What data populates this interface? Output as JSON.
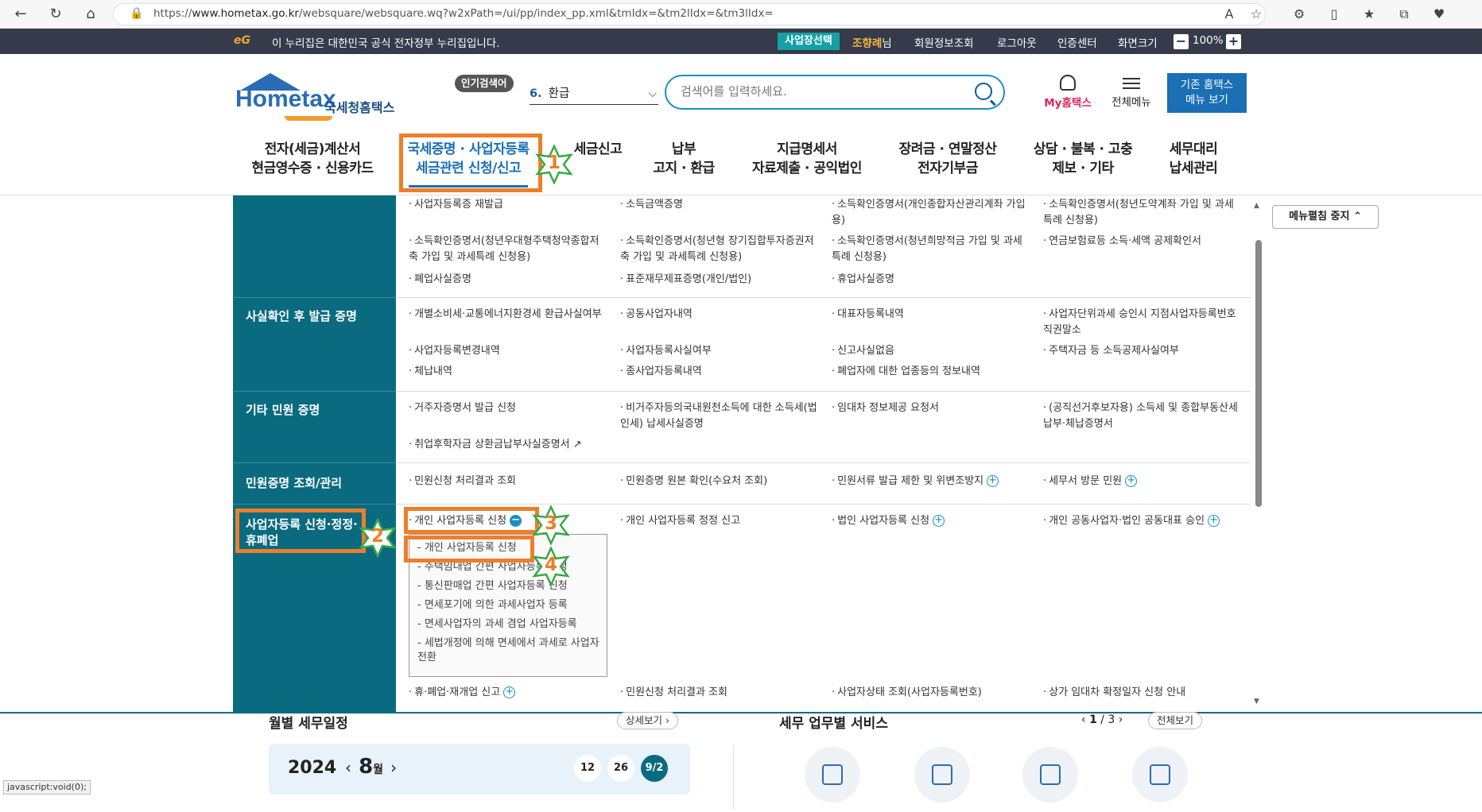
{
  "browser": {
    "url_prefix": "https://",
    "url_host": "www.hometax.go.kr",
    "url_path": "/websquare/websquare.wq?w2xPath=/ui/pp/index_pp.xml&tmIdx=&tm2lIdx=&tm3lIdx="
  },
  "topbar": {
    "gov_notice": "이 누리집은 대한민국 공식 전자정부 누리집입니다.",
    "biz_select": "사업장선택",
    "user_name": "조향례",
    "user_suffix": "님",
    "menus": [
      "회원정보조회",
      "로그아웃",
      "인증센터",
      "화면크기"
    ],
    "zoom": "100%"
  },
  "header": {
    "logo_text": "Hometax",
    "logo_sub": "국세청홈택스",
    "popular_tag": "인기검색어",
    "popular_num": "6.",
    "popular_term": "환급",
    "search_placeholder": "검색어를 입력하세요.",
    "my_hometax": "My홈택스",
    "all_menu": "전체메뉴",
    "old_hometax_line1": "기존 홈택스",
    "old_hometax_line2": "메뉴 보기"
  },
  "gnb": [
    {
      "l1": "전자(세금)계산서",
      "l2": "현금영수증 · 신용카드"
    },
    {
      "l1": "국세증명 · 사업자등록",
      "l2": "세금관련 신청/신고"
    },
    {
      "l1": "세금신고",
      "l2": ""
    },
    {
      "l1": "납부",
      "l2": "고지 · 환급"
    },
    {
      "l1": "지급명세서",
      "l2": "자료제출 · 공익법인"
    },
    {
      "l1": "장려금 · 연말정산",
      "l2": "전자기부금"
    },
    {
      "l1": "상담 · 불복 · 고충",
      "l2": "제보 · 기타"
    },
    {
      "l1": "세무대리",
      "l2": "납세관리"
    }
  ],
  "annotations": [
    "1",
    "2",
    "3",
    "4"
  ],
  "categories": [
    "사실확인 후 발급 증명",
    "기타 민원 증명",
    "민원증명 조회/관리",
    "사업자등록 신청·정정·휴폐업"
  ],
  "rows": {
    "r0": [
      "사업자등록증 재발급",
      "소득금액증명",
      "소득확인증명서(개인종합자산관리계좌 가입용)",
      "소득확인증명서(청년도약계좌 가입 및 과세특례 신청용)"
    ],
    "r1": [
      "소득확인증명서(청년우대형주택청약종합저축 가입 및 과세특례 신청용)",
      "소득확인증명서(청년형 장기집합투자증권저축 가입 및 과세특례 신청용)",
      "소득확인증명서(청년희망적금 가입 및 과세특례 신청용)",
      "연금보험료등 소득·세액 공제확인서"
    ],
    "r2": [
      "폐업사실증명",
      "표준재무제표증명(개인/법인)",
      "휴업사실증명"
    ],
    "r3": [
      "개별소비세·교통에너지환경세 환급사실여부",
      "공동사업자내역",
      "대표자등록내역",
      "사업자단위과세 승인시 지점사업자등록번호 직권말소"
    ],
    "r4": [
      "사업자등록변경내역",
      "사업자등록사실여부",
      "신고사실없음",
      "주택자금 등 소득공제사실여부"
    ],
    "r5": [
      "체납내역",
      "종사업자등록내역",
      "폐업자에 대한 업종등의 정보내역"
    ],
    "r6": [
      "거주자증명서 발급 신청",
      "비거주자등의국내원천소득에 대한 소득세(법인세) 납세사실증명",
      "임대차 정보제공 요청서",
      "(공직선거후보자용) 소득세 및 종합부동산세 납부·체납증명서"
    ],
    "r7": [
      "취업후학자금 상환금납부사실증명서"
    ],
    "r8": [
      "민원신청 처리결과 조회",
      "민원증명 원본 확인(수요처 조회)",
      "민원서류 발급 제한 및 위변조방지",
      "세무서 방문 민원"
    ],
    "r9": [
      "개인 사업자등록 신청",
      "개인 사업자등록 정정 신고",
      "법인 사업자등록 신청",
      "개인 공동사업자·법인 공동대표 승인"
    ],
    "r10": [
      "휴·폐업·재개업 신고",
      "민원신청 처리결과 조회",
      "사업자상태 조회(사업자등록번호)",
      "상가 임대차 확정일자 신청 안내"
    ]
  },
  "submenu": [
    "개인 사업자등록 신청",
    "주택임대업 간편 사업자등록 신청",
    "통신판매업 간편 사업자등록 신청",
    "면세포기에 의한 과세사업자 등록",
    "면세사업자의 과세 겸업 사업자등록",
    "세법개정에 의해 면세에서 과세로 사업자 전환"
  ],
  "stop_btn": "메뉴펼침 중지",
  "bottom": {
    "title_left": "월별 세무일정",
    "more_left": "상세보기",
    "title_right": "세무 업무별 서비스",
    "pager_cur": "1",
    "pager_total": "/ 3",
    "more_right": "전체보기",
    "year": "2024",
    "month": "8",
    "month_unit": "월",
    "days": [
      "12",
      "26",
      "9/2"
    ]
  },
  "status": "javascript:void(0);",
  "colors": {
    "accent": "#ee7e2a",
    "teal": "#0a6b80",
    "blue": "#1a6fb5"
  }
}
